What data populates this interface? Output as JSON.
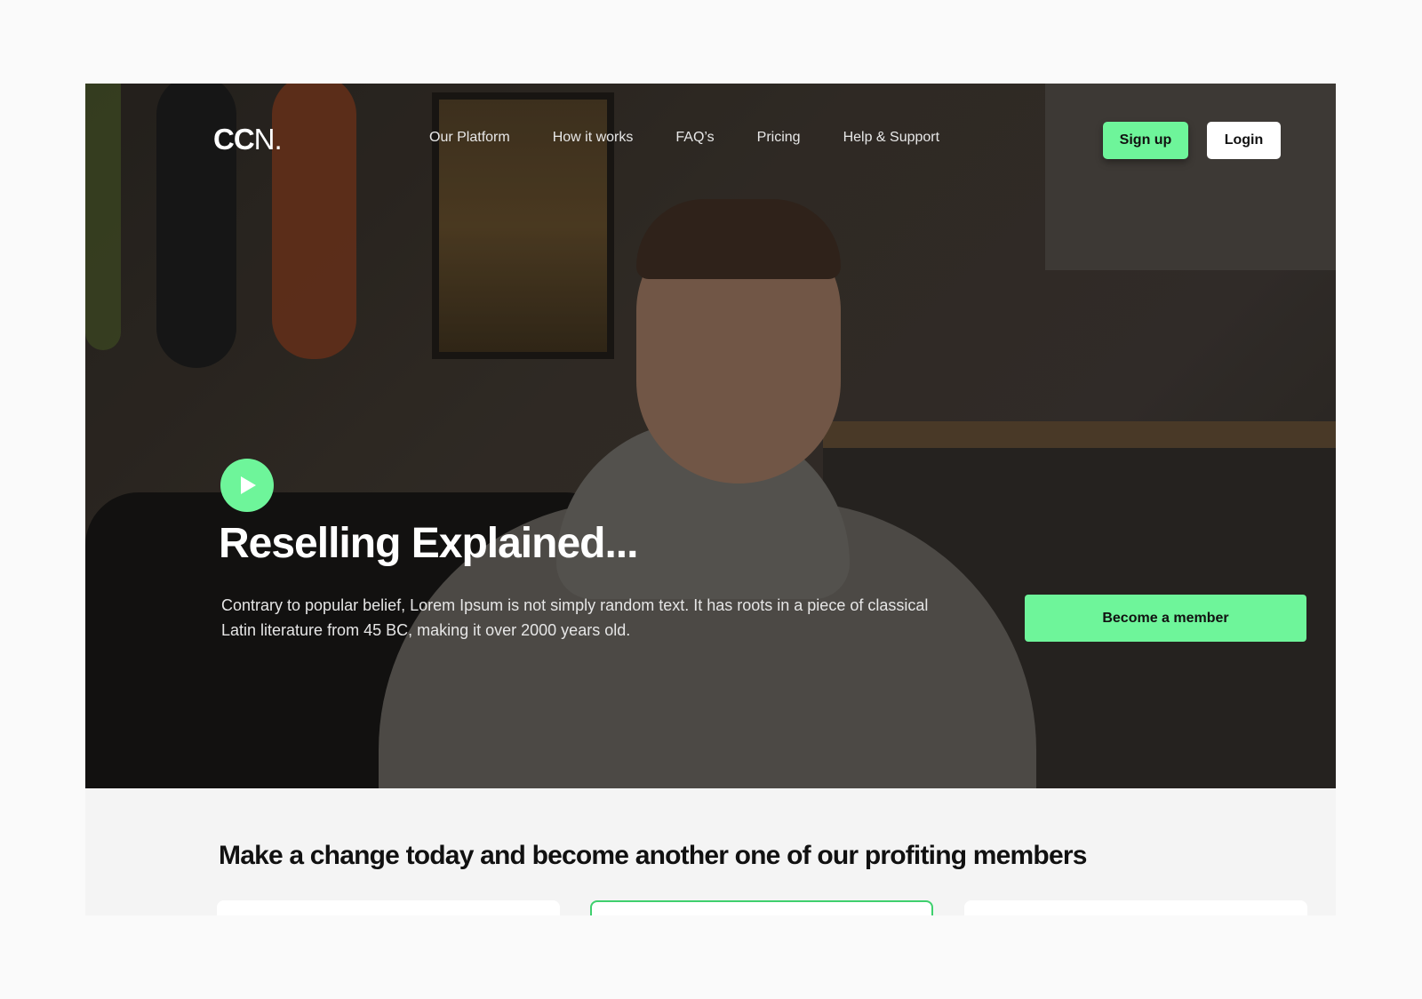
{
  "brand": {
    "logo_bold": "CC",
    "logo_rest": "N."
  },
  "nav": {
    "items": [
      {
        "label": "Our Platform"
      },
      {
        "label": "How it works"
      },
      {
        "label": "FAQ’s"
      },
      {
        "label": "Pricing"
      },
      {
        "label": "Help & Support"
      }
    ],
    "signup_label": "Sign up",
    "login_label": "Login"
  },
  "hero": {
    "title": "Reselling Explained...",
    "description": "Contrary to popular belief, Lorem Ipsum is not simply random text. It has roots in a piece of classical Latin literature from 45 BC, making it over 2000 years old.",
    "cta_label": "Become a member",
    "play_icon": "play-icon"
  },
  "section": {
    "title": "Make a change today and become another one of our profiting members"
  },
  "colors": {
    "accent": "#6ef59a",
    "accent_border": "#3fd06e",
    "page_bg": "#fafafa",
    "section_bg": "#f4f4f4"
  }
}
